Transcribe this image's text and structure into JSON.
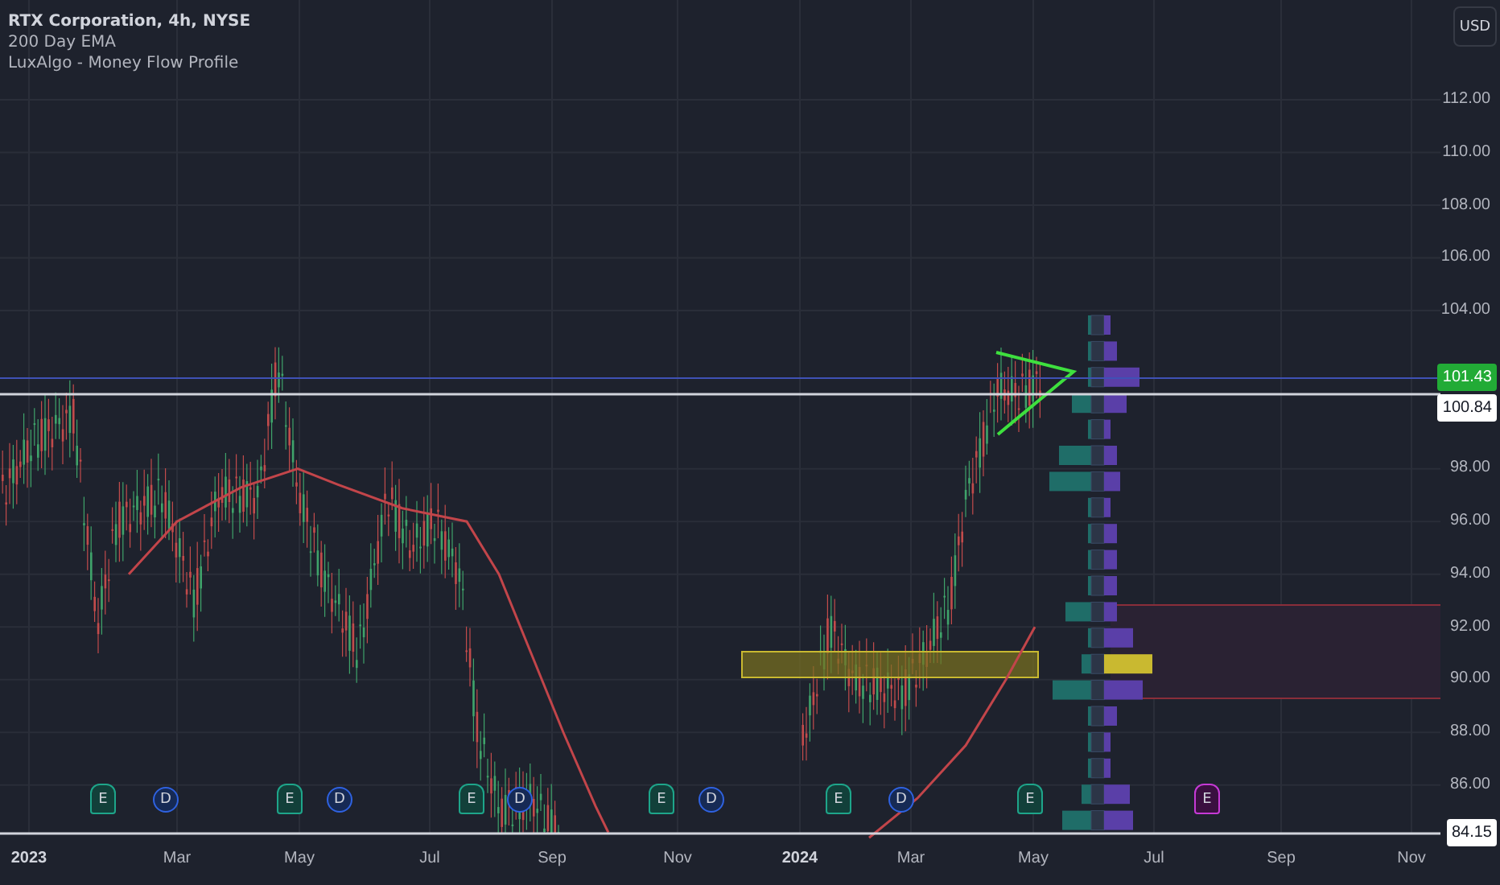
{
  "legend": {
    "symbol": "RTX Corporation, 4h, NYSE",
    "indicators": [
      "200 Day EMA",
      "LuxAlgo - Money Flow Profile"
    ]
  },
  "currency_button": "USD",
  "price_axis": {
    "ticks": [
      "112.00",
      "110.00",
      "108.00",
      "106.00",
      "104.00",
      "98.00",
      "96.00",
      "94.00",
      "92.00",
      "90.00",
      "88.00",
      "86.00"
    ],
    "last_price": "101.43",
    "ema_value": "100.84",
    "low_value": "84.15"
  },
  "time_axis": {
    "labels": [
      "2023",
      "Mar",
      "May",
      "Jul",
      "Sep",
      "Nov",
      "2024",
      "Mar",
      "May",
      "Jul",
      "Sep",
      "Nov"
    ]
  },
  "events": [
    {
      "kind": "earnings",
      "label": "E"
    },
    {
      "kind": "dividend",
      "label": "D"
    },
    {
      "kind": "earnings",
      "label": "E"
    },
    {
      "kind": "dividend",
      "label": "D"
    },
    {
      "kind": "earnings",
      "label": "E"
    },
    {
      "kind": "dividend",
      "label": "D"
    },
    {
      "kind": "earnings",
      "label": "E"
    },
    {
      "kind": "dividend",
      "label": "D"
    },
    {
      "kind": "earnings",
      "label": "E"
    },
    {
      "kind": "dividend",
      "label": "D"
    },
    {
      "kind": "earnings",
      "label": "E"
    },
    {
      "kind": "upcoming",
      "label": "E"
    }
  ]
}
